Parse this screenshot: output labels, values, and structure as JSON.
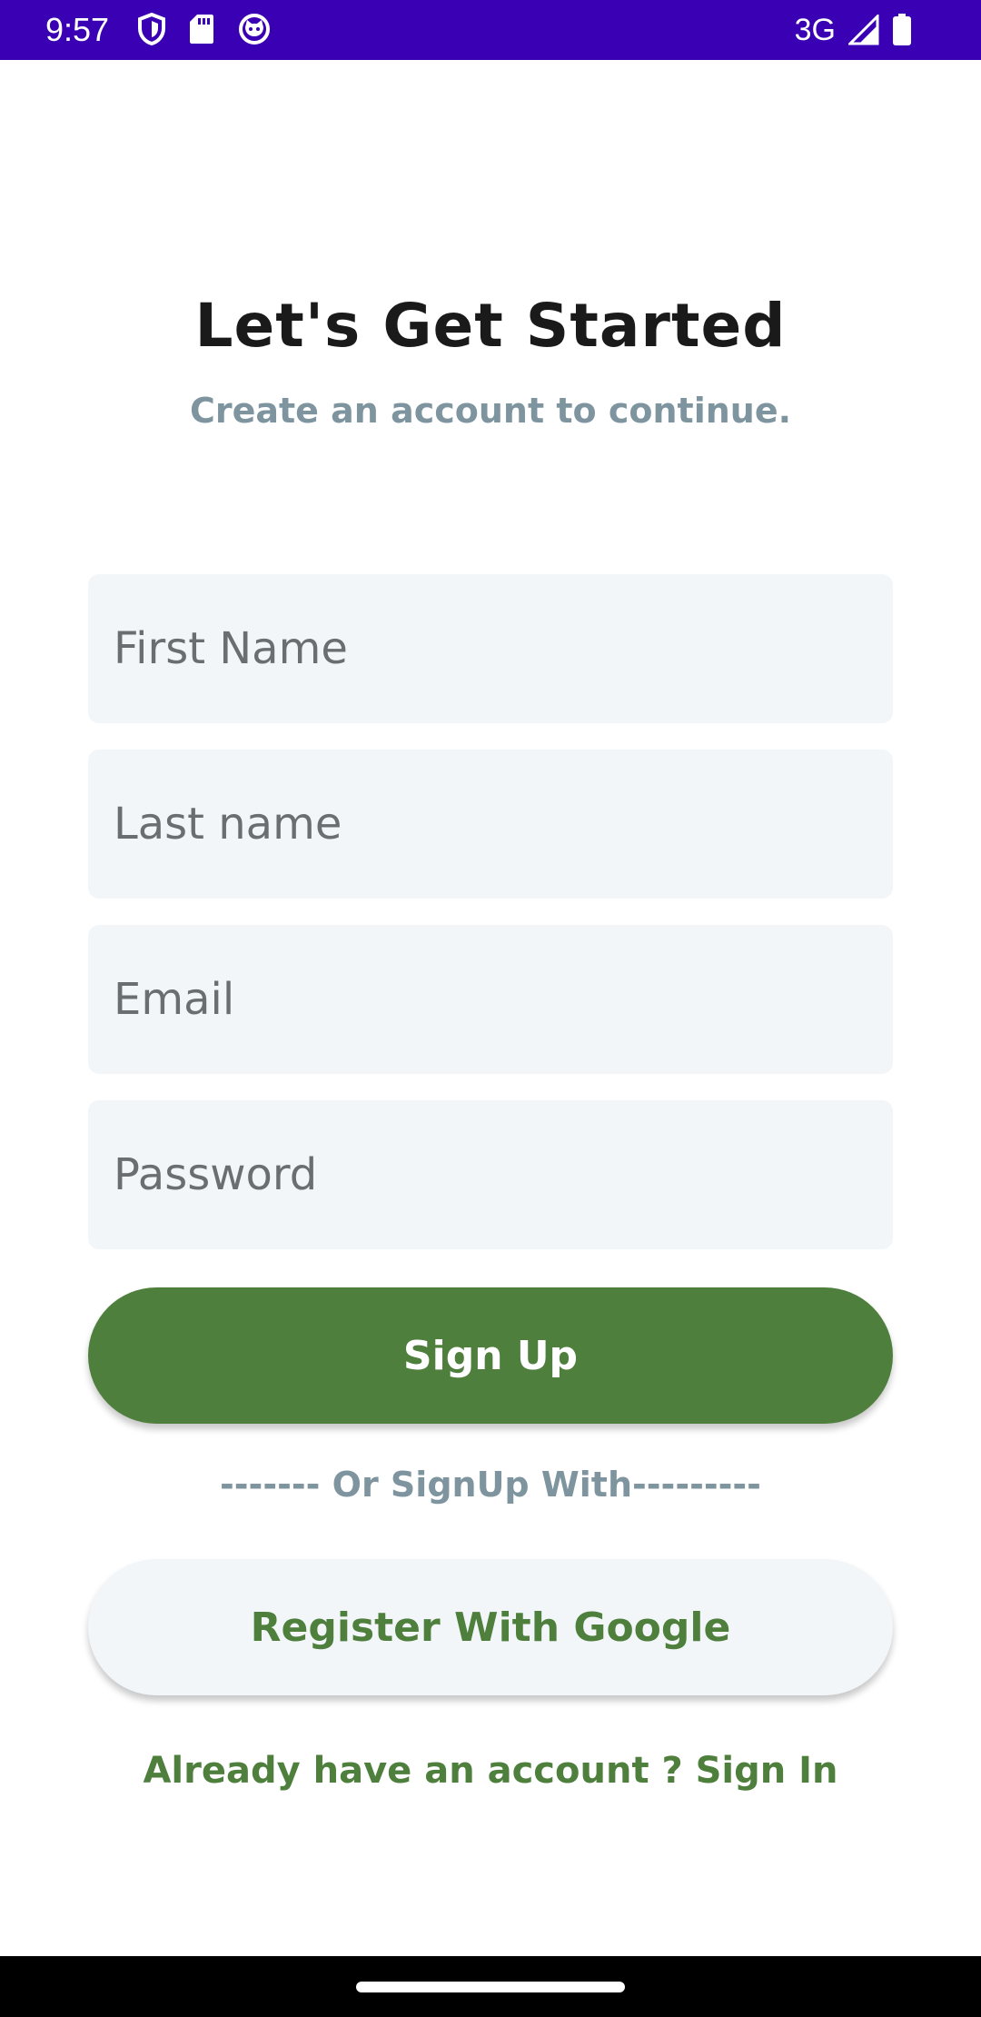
{
  "status_bar": {
    "time": "9:57",
    "network": "3G",
    "icons_left": [
      "shield-icon",
      "sd-card-icon",
      "cat-face-icon"
    ],
    "icons_right": [
      "signal-icon",
      "battery-icon"
    ],
    "background": "#3a00b3"
  },
  "header": {
    "title": "Let's Get Started",
    "subtitle": "Create an account to continue."
  },
  "form": {
    "first_name_placeholder": "First Name",
    "last_name_placeholder": "Last name",
    "email_placeholder": "Email",
    "password_placeholder": "Password",
    "signup_label": "Sign Up"
  },
  "alternative": {
    "divider_text": "------- Or SignUp With---------",
    "google_label": "Register With Google"
  },
  "footer": {
    "signin_text": "Already have an account ? Sign In"
  },
  "colors": {
    "accent": "#4e7f3c",
    "muted": "#7e949f",
    "field_bg": "#f2f6f9"
  }
}
